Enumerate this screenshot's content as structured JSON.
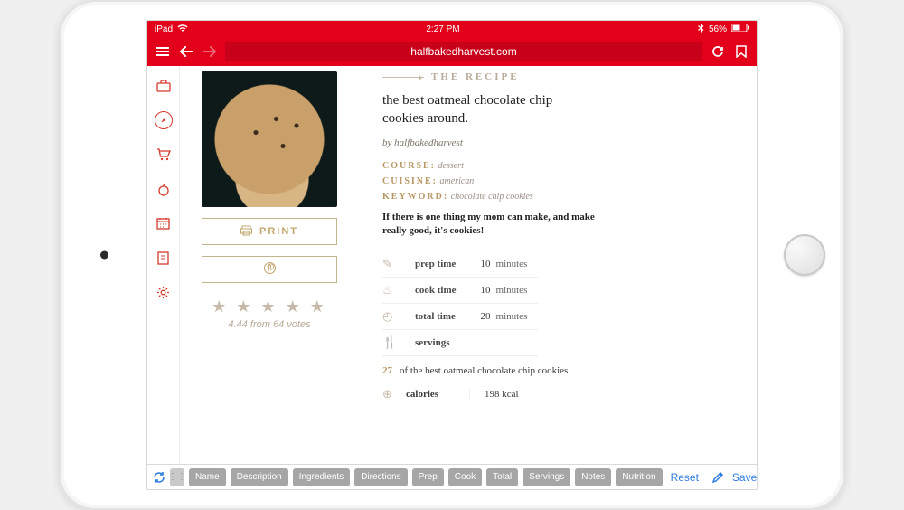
{
  "status": {
    "carrier": "iPad",
    "time": "2:27 PM",
    "bt": "✳",
    "battery_pct": "56%"
  },
  "browser": {
    "url_display": "halfbakedharvest.com"
  },
  "left_col": {
    "print_label": "PRINT",
    "rating_value": "4.44",
    "rating_from": " from ",
    "rating_votes": "64 votes"
  },
  "recipe": {
    "section_label": "THE RECIPE",
    "title": "the best oatmeal chocolate chip cookies around.",
    "byline": "by halfbakedharvest",
    "meta": {
      "course_key": "COURSE:",
      "course_val": "dessert",
      "cuisine_key": "CUISINE:",
      "cuisine_val": "american",
      "keyword_key": "KEYWORD:",
      "keyword_val": "chocolate chip cookies"
    },
    "blurb": "If there is one thing my mom can make, and make really good, it's cookies!",
    "timing": {
      "prep_label": "prep time",
      "prep_val": "10",
      "prep_unit": "minutes",
      "cook_label": "cook time",
      "cook_val": "10",
      "cook_unit": "minutes",
      "total_label": "total time",
      "total_val": "20",
      "total_unit": "minutes",
      "servings_label": "servings"
    },
    "yield_num": "27",
    "yield_text": "of the best oatmeal chocolate chip cookies",
    "calories_label": "calories",
    "calories_val": "198 kcal"
  },
  "bottom": {
    "tags": [
      "Name",
      "Description",
      "Ingredients",
      "Directions",
      "Prep",
      "Cook",
      "Total",
      "Servings",
      "Notes",
      "Nutrition"
    ],
    "reset": "Reset",
    "save": "Save"
  }
}
